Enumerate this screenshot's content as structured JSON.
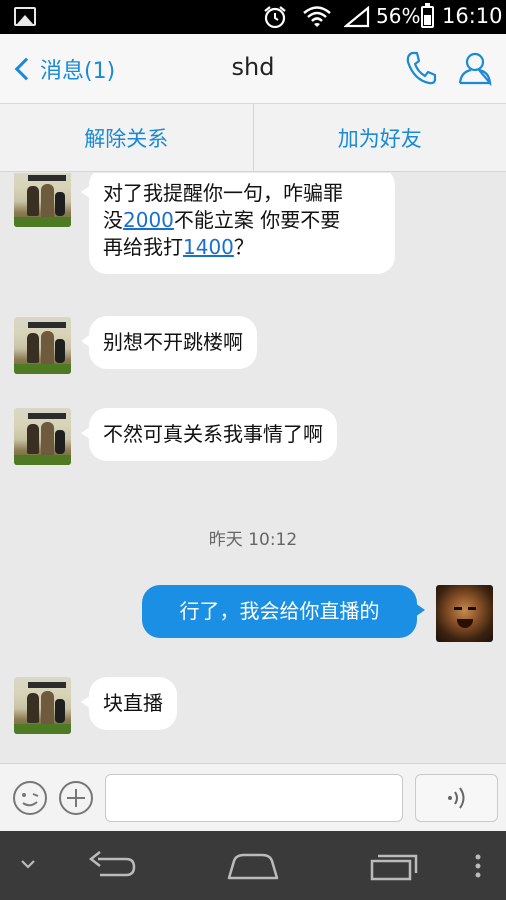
{
  "status_bar": {
    "battery_percent": "56%",
    "time": "16:10"
  },
  "header": {
    "back_label": "消息(1)",
    "title": "shd"
  },
  "actions": {
    "remove_relation": "解除关系",
    "add_friend": "加为好友"
  },
  "messages": [
    {
      "side": "left",
      "parts": [
        "对了我提醒你一句，咋骗罪",
        "没",
        "2000",
        "不能立案  你要不要",
        "再给我打",
        "1400",
        "？"
      ]
    },
    {
      "side": "left",
      "text": "别想不开跳楼啊"
    },
    {
      "side": "left",
      "text": "不然可真关系我事情了啊"
    },
    {
      "timestamp": "昨天 10:12"
    },
    {
      "side": "right",
      "text": "行了，我会给你直播的"
    },
    {
      "side": "left",
      "text": "块直播"
    }
  ],
  "input": {
    "value": "",
    "placeholder": ""
  },
  "colors": {
    "accent": "#1a8ad6",
    "outgoing_bubble": "#1a8fe3",
    "incoming_bubble": "#ffffff",
    "chat_background": "#e9e9e9"
  },
  "icons": [
    "image-icon",
    "alarm-icon",
    "wifi-icon",
    "signal-icon",
    "battery-icon",
    "back-chevron-icon",
    "phone-icon",
    "profile-icon",
    "emoji-icon",
    "plus-icon",
    "voice-icon",
    "nav-down-icon",
    "nav-back-icon",
    "nav-home-icon",
    "nav-recent-icon",
    "nav-menu-icon"
  ]
}
